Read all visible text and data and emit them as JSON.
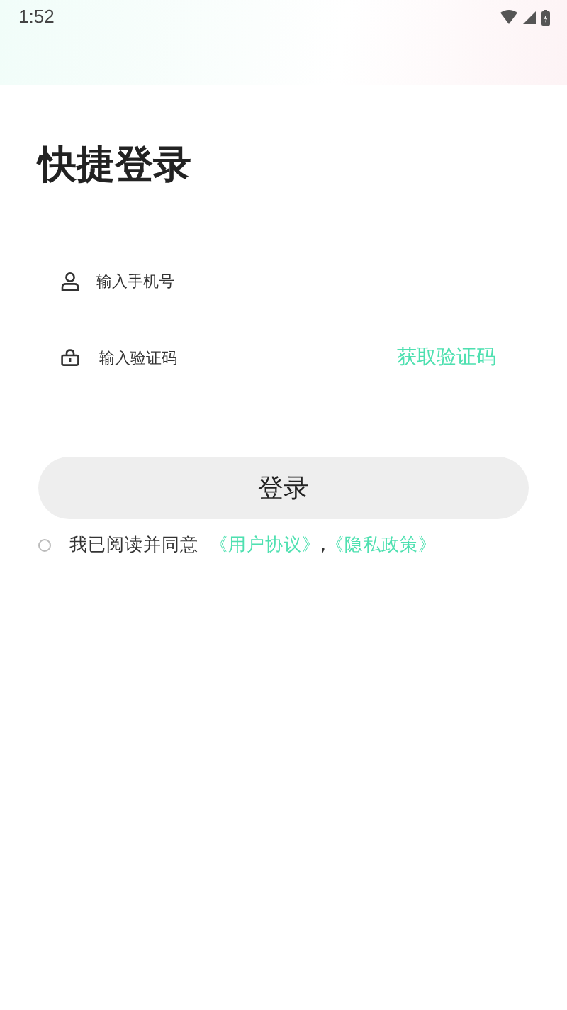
{
  "status_bar": {
    "time": "1:52"
  },
  "title": "快捷登录",
  "phone_field": {
    "placeholder": "输入手机号"
  },
  "code_field": {
    "placeholder": "输入验证码"
  },
  "get_code_link": "获取验证码",
  "login_button": "登录",
  "agreement": {
    "checked": false,
    "text": "我已阅读并同意",
    "links": [
      "《用户协议》",
      "《隐私政策》"
    ],
    "separator": ","
  }
}
